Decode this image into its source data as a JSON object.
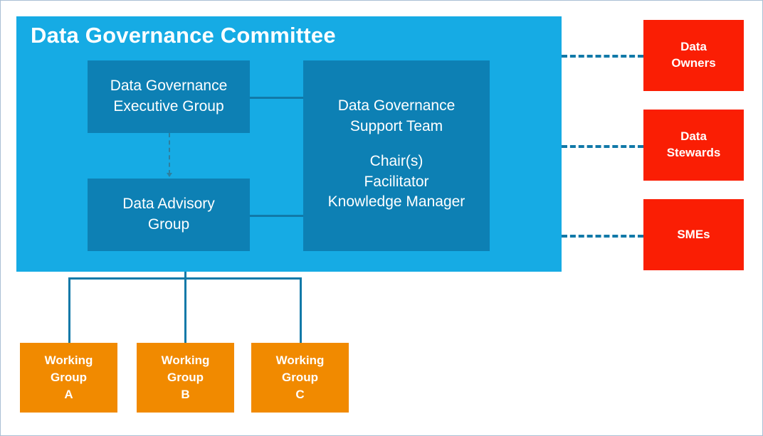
{
  "diagram": {
    "title": "Data Governance Committee",
    "committee": {
      "title": "Data Governance Committee",
      "boxes": [
        {
          "id": "executive-group",
          "lines": [
            "Data Governance",
            "Executive Group"
          ]
        },
        {
          "id": "advisory-group",
          "lines": [
            "Data Advisory",
            "Group"
          ]
        },
        {
          "id": "support-team",
          "lines": [
            "Data Governance",
            "Support Team"
          ],
          "roles": [
            "Chair(s)",
            "Facilitator",
            "Knowledge Manager"
          ]
        }
      ]
    },
    "stakeholders": [
      {
        "id": "data-owners",
        "lines": [
          "Data",
          "Owners"
        ]
      },
      {
        "id": "data-stewards",
        "lines": [
          "Data",
          "Stewards"
        ]
      },
      {
        "id": "smes",
        "lines": [
          "SMEs"
        ]
      }
    ],
    "working_groups": [
      {
        "id": "working-group-a",
        "lines": [
          "Working",
          "Group",
          "A"
        ]
      },
      {
        "id": "working-group-b",
        "lines": [
          "Working",
          "Group",
          "B"
        ]
      },
      {
        "id": "working-group-c",
        "lines": [
          "Working",
          "Group",
          "C"
        ]
      }
    ],
    "colors": {
      "panel": "#16abe4",
      "inner_box": "#0d80b4",
      "stakeholder": "#fa1e04",
      "working_group": "#f18a00",
      "connector": "#1179a8",
      "border": "#aabfd4",
      "text": "#ffffff"
    }
  }
}
